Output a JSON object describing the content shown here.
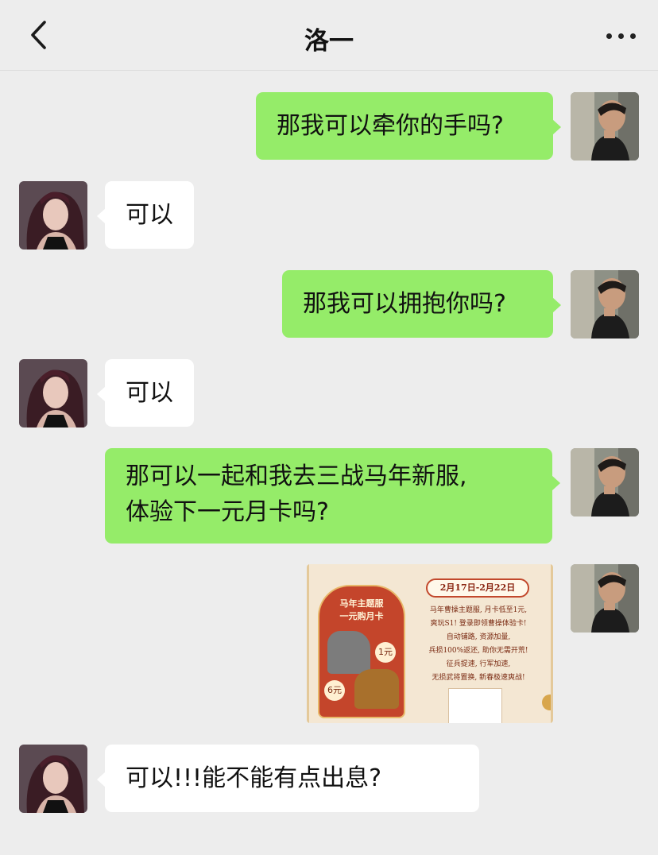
{
  "header": {
    "title": "洛一"
  },
  "messages": [
    {
      "sender": "me",
      "text": "那我可以牵你的手吗?"
    },
    {
      "sender": "her",
      "text": "可以"
    },
    {
      "sender": "me",
      "text": "那我可以拥抱你吗?"
    },
    {
      "sender": "her",
      "text": "可以"
    },
    {
      "sender": "me",
      "line1": "那可以一起和我去三战马年新服,",
      "line2": "体验下一元月卡吗?"
    },
    {
      "sender": "me",
      "type": "image",
      "ad": {
        "panel_title_1": "马年主题服",
        "panel_title_2": "一元购月卡",
        "tag_small": "1元",
        "tag_large": "6元",
        "date_range": "2月17日-2月22日",
        "lines": [
          "马年曹操主题服, 月卡低至1元,",
          "爽玩S1! 登录即领曹操体验卡!",
          "自动铺路, 资源加量,",
          "兵损100%返还, 助你无需开荒!",
          "征兵提速, 行军加速,",
          "无损武将置换, 新春极速爽战!"
        ]
      }
    },
    {
      "sender": "her",
      "text": "可以!!!能不能有点出息?"
    }
  ],
  "colors": {
    "background": "#ededed",
    "my_bubble": "#95ec69",
    "her_bubble": "#ffffff"
  },
  "icons": {
    "back": "chevron-left-icon",
    "more": "more-dots-icon"
  }
}
